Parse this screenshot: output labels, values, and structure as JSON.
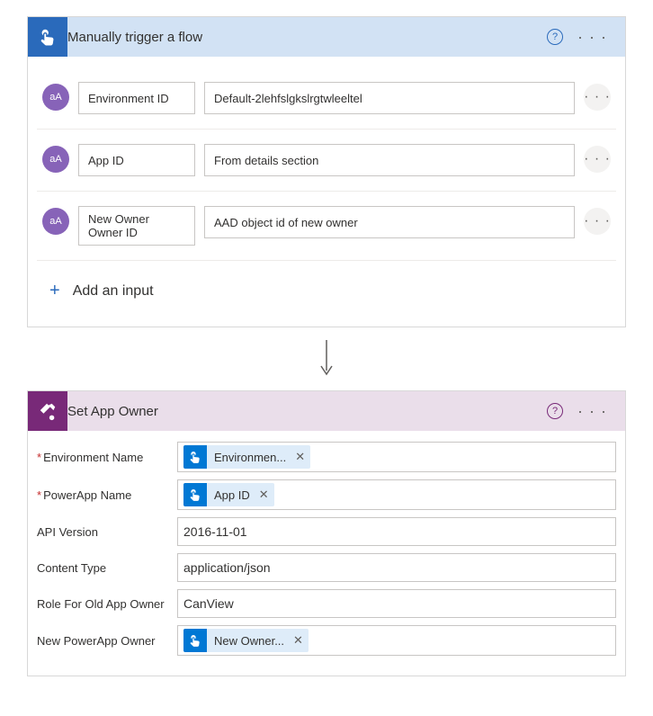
{
  "trigger": {
    "title": "Manually trigger a flow",
    "icon": "tap-icon",
    "inputs": [
      {
        "badge": "aA",
        "name": "Environment ID",
        "value": "Default-2lehfslgkslrgtwleeltel"
      },
      {
        "badge": "aA",
        "name": "App ID",
        "value": "From details section"
      },
      {
        "badge": "aA",
        "name": "New Owner Owner ID",
        "value": "AAD object id of new owner"
      }
    ],
    "add_input_label": "Add an input"
  },
  "action": {
    "title": "Set App Owner",
    "icon": "app-admin-icon",
    "rows": [
      {
        "label": "Environment Name",
        "required": true,
        "type": "token",
        "token": "Environmen..."
      },
      {
        "label": "PowerApp Name",
        "required": true,
        "type": "token",
        "token": "App ID"
      },
      {
        "label": "API Version",
        "required": false,
        "type": "text",
        "value": "2016-11-01"
      },
      {
        "label": "Content Type",
        "required": false,
        "type": "text",
        "value": "application/json"
      },
      {
        "label": "Role For Old App Owner",
        "required": false,
        "type": "text",
        "value": "CanView"
      },
      {
        "label": "New PowerApp Owner",
        "required": false,
        "type": "token",
        "token": "New Owner..."
      }
    ]
  },
  "ui": {
    "help": "?",
    "ellipsis": "· · ·",
    "close_token": "✕",
    "plus": "+"
  }
}
